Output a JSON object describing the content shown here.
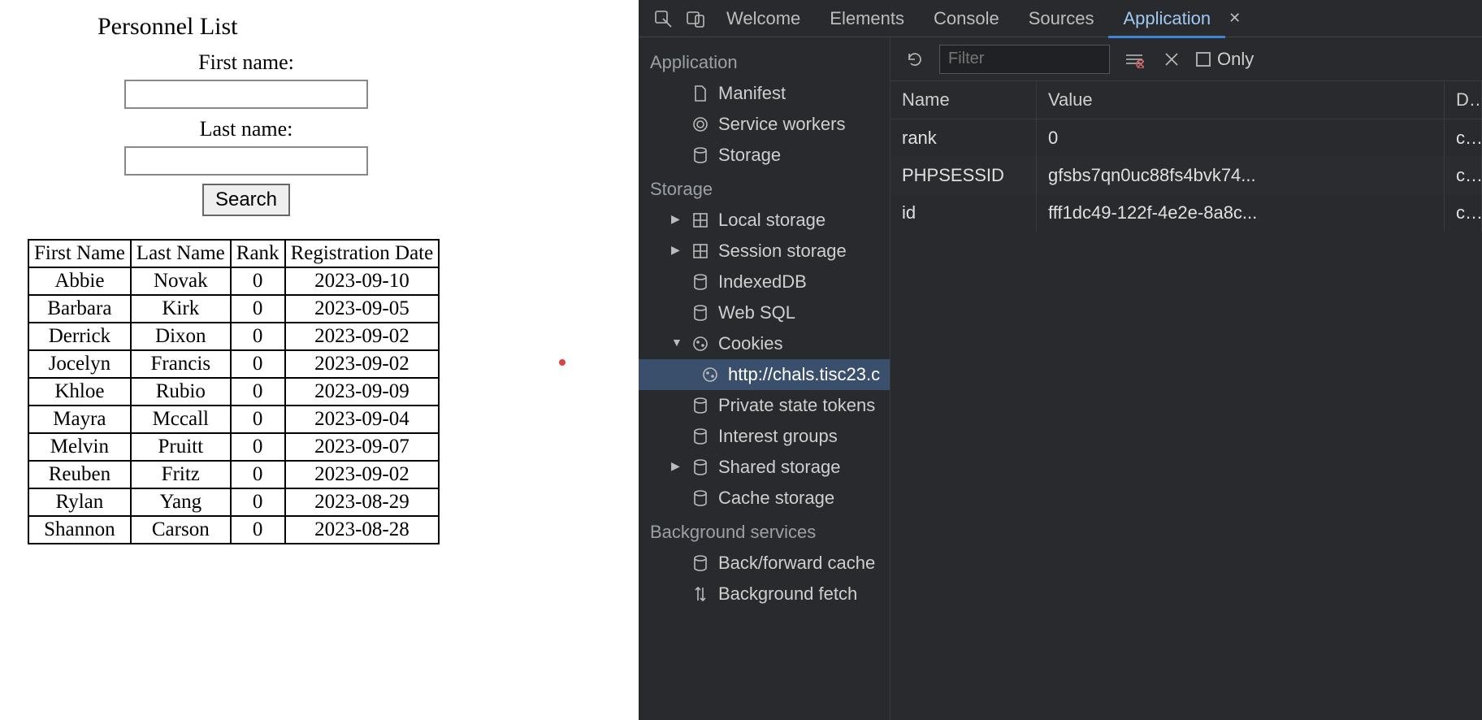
{
  "page": {
    "title": "Personnel List",
    "form": {
      "first_name_label": "First name:",
      "last_name_label": "Last name:",
      "first_name_value": "",
      "last_name_value": "",
      "search_label": "Search"
    },
    "table": {
      "headers": [
        "First Name",
        "Last Name",
        "Rank",
        "Registration Date"
      ],
      "rows": [
        [
          "Abbie",
          "Novak",
          "0",
          "2023-09-10"
        ],
        [
          "Barbara",
          "Kirk",
          "0",
          "2023-09-05"
        ],
        [
          "Derrick",
          "Dixon",
          "0",
          "2023-09-02"
        ],
        [
          "Jocelyn",
          "Francis",
          "0",
          "2023-09-02"
        ],
        [
          "Khloe",
          "Rubio",
          "0",
          "2023-09-09"
        ],
        [
          "Mayra",
          "Mccall",
          "0",
          "2023-09-04"
        ],
        [
          "Melvin",
          "Pruitt",
          "0",
          "2023-09-07"
        ],
        [
          "Reuben",
          "Fritz",
          "0",
          "2023-09-02"
        ],
        [
          "Rylan",
          "Yang",
          "0",
          "2023-08-29"
        ],
        [
          "Shannon",
          "Carson",
          "0",
          "2023-08-28"
        ]
      ]
    }
  },
  "devtools": {
    "tabs": {
      "welcome": "Welcome",
      "elements": "Elements",
      "console": "Console",
      "sources": "Sources",
      "application": "Application"
    },
    "active_tab": "Application",
    "toolbar": {
      "filter_placeholder": "Filter",
      "only_label": "Only"
    },
    "sidebar": {
      "application_heading": "Application",
      "application_items": [
        "Manifest",
        "Service workers",
        "Storage"
      ],
      "storage_heading": "Storage",
      "storage_items": {
        "local_storage": "Local storage",
        "session_storage": "Session storage",
        "indexeddb": "IndexedDB",
        "websql": "Web SQL",
        "cookies": "Cookies",
        "cookies_url": "http://chals.tisc23.c",
        "private_state_tokens": "Private state tokens",
        "interest_groups": "Interest groups",
        "shared_storage": "Shared storage",
        "cache_storage": "Cache storage"
      },
      "background_heading": "Background services",
      "background_items": [
        "Back/forward cache",
        "Background fetch"
      ]
    },
    "cookies": {
      "headers": {
        "name": "Name",
        "value": "Value",
        "d": "D..."
      },
      "rows": [
        {
          "name": "rank",
          "value": "0",
          "d": "c..."
        },
        {
          "name": "PHPSESSID",
          "value": "gfsbs7qn0uc88fs4bvk74...",
          "d": "c..."
        },
        {
          "name": "id",
          "value": "fff1dc49-122f-4e2e-8a8c...",
          "d": "c..."
        }
      ]
    }
  }
}
